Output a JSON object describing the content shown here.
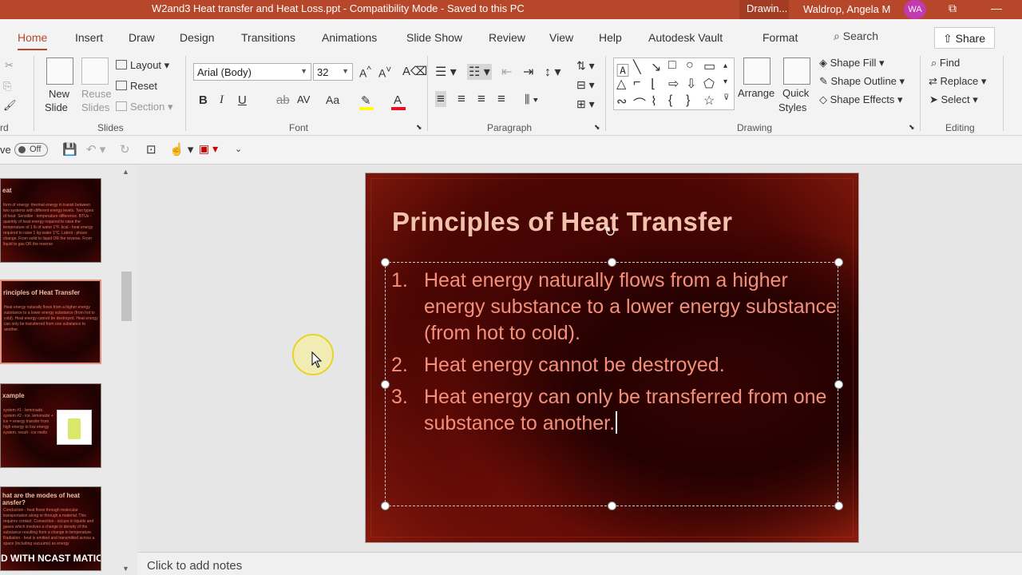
{
  "titlebar": {
    "doc_title": "W2and3 Heat transfer and Heat Loss.ppt  -  Compatibility Mode  -  Saved to this PC",
    "drawing_tab": "Drawin...",
    "user_name": "Waldrop, Angela M",
    "avatar_initials": "WA"
  },
  "tabs": [
    "Home",
    "Insert",
    "Draw",
    "Design",
    "Transitions",
    "Animations",
    "Slide Show",
    "Review",
    "View",
    "Help",
    "Autodesk Vault",
    "Format"
  ],
  "search_label": "Search",
  "share_label": "Share",
  "ribbon": {
    "clipboard_label": "rd",
    "slides": {
      "new_slide": "New",
      "new_slide2": "Slide",
      "reuse": "Reuse",
      "reuse2": "Slides",
      "layout": "Layout",
      "reset": "Reset",
      "section": "Section",
      "group": "Slides"
    },
    "font": {
      "name": "Arial (Body)",
      "size": "32",
      "bold": "B",
      "italic": "I",
      "underline": "U",
      "strike": "ab",
      "spacing": "AV",
      "case": "Aa",
      "group": "Font"
    },
    "paragraph_group": "Paragraph",
    "drawing": {
      "arrange": "Arrange",
      "quick": "Quick",
      "styles": "Styles",
      "fill": "Shape Fill",
      "outline": "Shape Outline",
      "effects": "Shape Effects",
      "group": "Drawing"
    },
    "editing": {
      "find": "Find",
      "replace": "Replace",
      "select": "Select",
      "group": "Editing"
    }
  },
  "qat": {
    "autosave_prefix": "ve",
    "toggle": "Off"
  },
  "thumbnails": [
    {
      "title": "eat",
      "body": "form of energy: thermal energy in transit between two systems with different energy levels. Two types of heat: Sensible - temperature difference. BTUs - quantity of heat energy required to raise the temperature of 1 lb of water 1°F. kcal - heat energy required to raise 1 kg water 1°C. Latent - phase change. From solid to liquid OR the reverse. From liquid to gas OR the reverse"
    },
    {
      "title": "rinciples of Heat Transfer",
      "body": "Heat energy naturally flows from a higher energy substance to a lower energy substance (from hot to cold). Heat energy cannot be destroyed. Heat energy can only be transferred from one substance to another."
    },
    {
      "title": "xample",
      "body": "system #1 - lemonade. system #2 - ice. lemonade + ice = energy transfer from high energy to low energy system. result - ice melts"
    },
    {
      "title": "hat are the modes of heat ansfer?",
      "body": "Conduction - heat flows through molecular transportation along or through a material. This requires contact. Convection - occurs in liquids and gases which involves a change in density of the substance resulting from a change in temperature. Radiation - heat is emitted and transmitted across a space (including vacuums) as energy",
      "watermark": "D WITH NCAST MATIC"
    }
  ],
  "slide": {
    "title": "Principles of Heat Transfer",
    "bullets": [
      {
        "num": "1.",
        "text": "Heat energy naturally flows from a higher energy substance to a lower energy substance (from hot to cold)."
      },
      {
        "num": "2.",
        "text": "Heat energy cannot be destroyed."
      },
      {
        "num": "3.",
        "text": "Heat energy can only be transferred from one substance to another."
      }
    ]
  },
  "notes_placeholder": "Click to add notes",
  "colors": {
    "accent": "#b7472a",
    "slide_title": "#f2c2ad",
    "slide_text": "#f4907a"
  }
}
